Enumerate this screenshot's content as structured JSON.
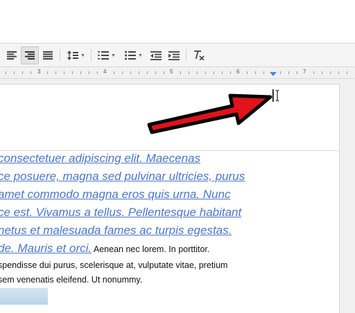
{
  "ruler": {
    "numbers": [
      "3",
      "4",
      "5",
      "6",
      "7"
    ]
  },
  "document": {
    "link_lines": [
      "consectetuer adipiscing elit. Maecenas",
      "ce posuere, magna sed pulvinar ultricies, purus",
      "amet commodo magna eros quis urna. Nunc",
      "ce est. Vivamus a tellus. Pellentesque habitant",
      "netus et malesuada fames ac turpis egestas.",
      "de. Mauris et orci."
    ],
    "normal_line_tail": " Aenean nec lorem. In porttitor.",
    "normal_lines": [
      "spendisse dui purus, scelerisque at, vulputate vitae, pretium",
      "sem venenatis eleifend. Ut nonummy."
    ]
  },
  "colors": {
    "link": "#4a76c9",
    "arrow_fill": "#e0121b",
    "indent_marker": "#4a86e8"
  },
  "icons": {
    "align_left": "align-left-icon",
    "align_right": "align-right-icon",
    "justify": "align-justify-icon",
    "line_spacing": "line-spacing-icon",
    "numbered_list": "numbered-list-icon",
    "bulleted_list": "bulleted-list-icon",
    "decrease_indent": "decrease-indent-icon",
    "increase_indent": "increase-indent-icon",
    "clear_formatting": "clear-formatting-icon",
    "text_cursor": "text-cursor-icon",
    "callout_arrow": "red-arrow-icon"
  }
}
